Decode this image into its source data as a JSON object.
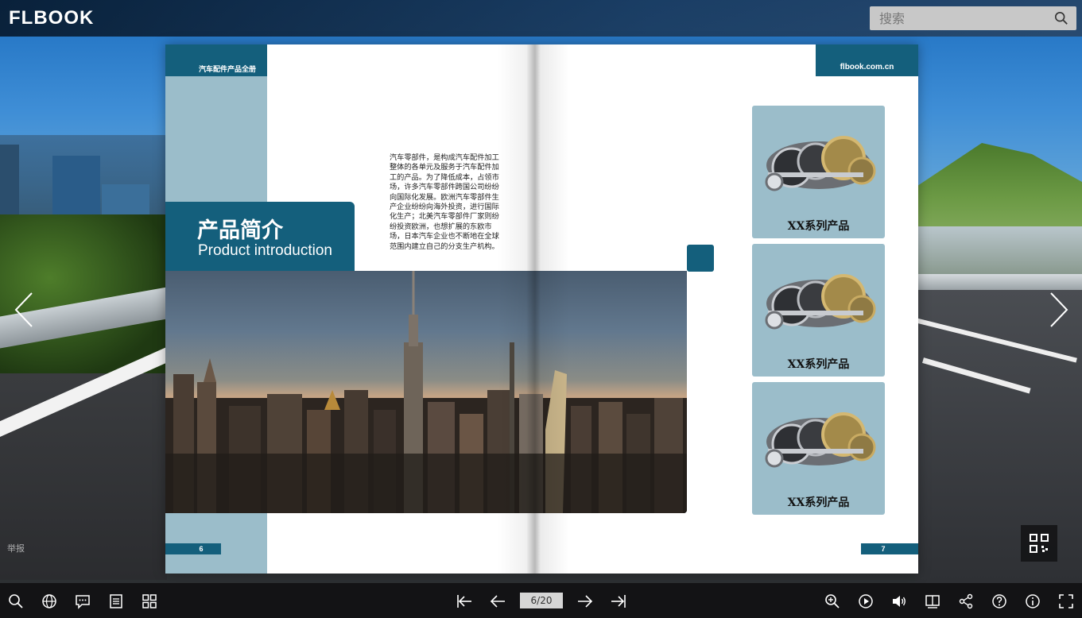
{
  "app": {
    "logo": "FLBOOK",
    "search": {
      "placeholder": "搜索"
    }
  },
  "book": {
    "left_page": {
      "header": "汽车配件产品全册",
      "title_cn": "产品简介",
      "title_en": "Product introduction",
      "body": "汽车零部件，是构成汽车配件加工整体的各单元及服务于汽车配件加工的产品。为了降低成本，占领市场，许多汽车零部件跨国公司纷纷向国际化发展。欧洲汽车零部件生产企业纷纷向海外投资，进行国际化生产；北美汽车零部件厂家则纷纷投资欧洲，也想扩展的东欧市场，日本汽车企业也不断地在全球范围内建立自己的分支生产机构。",
      "page_number": "6"
    },
    "right_page": {
      "header": "flbook.com.cn",
      "products": [
        {
          "label": "XX系列产品"
        },
        {
          "label": "XX系列产品"
        },
        {
          "label": "XX系列产品"
        }
      ],
      "page_number": "7"
    }
  },
  "overlay": {
    "report": "举报"
  },
  "toolbar": {
    "page_indicator": "6/20",
    "left_icons": [
      "search-icon",
      "globe-icon",
      "comment-icon",
      "table-of-contents-icon",
      "thumbnails-icon"
    ],
    "nav_icons": [
      "first-page-icon",
      "previous-page-icon",
      "next-page-icon",
      "last-page-icon"
    ],
    "right_icons": [
      "zoom-in-icon",
      "autoplay-icon",
      "sound-icon",
      "book-mode-icon",
      "share-icon",
      "help-icon",
      "info-icon",
      "fullscreen-icon"
    ]
  },
  "colors": {
    "brand": "#145f7c",
    "light_panel": "#9bbdca"
  }
}
